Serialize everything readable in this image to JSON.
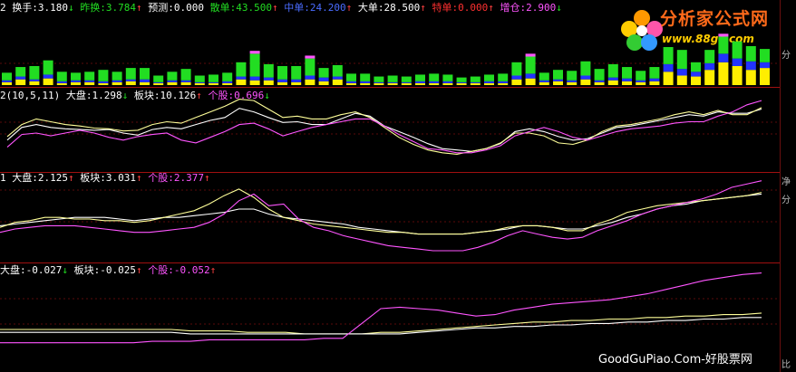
{
  "header": {
    "turnover_label": "换手:",
    "turnover_value": "3.180",
    "turnover_arrow": "↓",
    "prev_label": "昨换:",
    "prev_value": "3.784",
    "prev_arrow": "↑",
    "forecast_label": "预测:",
    "forecast_value": "0.000",
    "retail_label": "散单:",
    "retail_value": "43.500",
    "retail_arrow": "↑",
    "mid_label": "中单:",
    "mid_value": "24.200",
    "mid_arrow": "↑",
    "large_label": "大单:",
    "large_value": "28.500",
    "large_arrow": "↑",
    "xl_label": "特单:",
    "xl_value": "0.000",
    "xl_arrow": "↑",
    "add_label": "增仓:",
    "add_value": "2.900",
    "add_arrow": "↓"
  },
  "panel1": {
    "prefix": "2(10,5,11)",
    "market_label": "大盘:",
    "market_value": "1.298",
    "market_arrow": "↓",
    "sector_label": "板块:",
    "sector_value": "10.126",
    "sector_arrow": "↑",
    "stock_label": "个股:",
    "stock_value": "0.696",
    "stock_arrow": "↓"
  },
  "panel2": {
    "prefix": "1",
    "market_label": "大盘:",
    "market_value": "2.125",
    "market_arrow": "↑",
    "sector_label": "板块:",
    "sector_value": "3.031",
    "sector_arrow": "↑",
    "stock_label": "个股:",
    "stock_value": "2.377",
    "stock_arrow": "↑"
  },
  "panel3": {
    "market_label": "大盘:",
    "market_value": "-0.027",
    "market_arrow": "↓",
    "sector_label": "板块:",
    "sector_value": "-0.025",
    "sector_arrow": "↑",
    "stock_label": "个股:",
    "stock_value": "-0.052",
    "stock_arrow": "↑"
  },
  "logo": {
    "title": "分析家公式网",
    "url": "www.88gs.com"
  },
  "watermark": "GoodGuPiao.Com-好股票网",
  "edge_labels": {
    "a": "分",
    "b": "净",
    "c": "分",
    "d": "比"
  },
  "colors": {
    "green": "#22dd22",
    "blue": "#2233ff",
    "yellow": "#ffee00",
    "magenta": "#ff55ff",
    "white": "#ffffff",
    "paleyellow": "#ffff99"
  },
  "chart_data": [
    {
      "type": "bar",
      "name": "volume",
      "layers": [
        "yellow",
        "blue",
        "green",
        "magenta"
      ],
      "values": [
        [
          3,
          2,
          8,
          0
        ],
        [
          6,
          3,
          10,
          0
        ],
        [
          4,
          2,
          14,
          0
        ],
        [
          7,
          4,
          15,
          0
        ],
        [
          2,
          2,
          10,
          0
        ],
        [
          3,
          2,
          8,
          0
        ],
        [
          3,
          2,
          9,
          0
        ],
        [
          2,
          2,
          12,
          0
        ],
        [
          3,
          2,
          9,
          0
        ],
        [
          4,
          2,
          12,
          0
        ],
        [
          3,
          3,
          12,
          0
        ],
        [
          2,
          1,
          7,
          0
        ],
        [
          3,
          2,
          9,
          0
        ],
        [
          3,
          2,
          12,
          0
        ],
        [
          2,
          1,
          7,
          0
        ],
        [
          2,
          1,
          8,
          0
        ],
        [
          2,
          2,
          9,
          0
        ],
        [
          6,
          3,
          15,
          0
        ],
        [
          5,
          4,
          24,
          3
        ],
        [
          5,
          3,
          14,
          0
        ],
        [
          3,
          3,
          14,
          0
        ],
        [
          3,
          3,
          14,
          0
        ],
        [
          6,
          4,
          18,
          3
        ],
        [
          4,
          4,
          10,
          0
        ],
        [
          6,
          3,
          12,
          0
        ],
        [
          2,
          2,
          8,
          0
        ],
        [
          2,
          2,
          8,
          0
        ],
        [
          2,
          1,
          6,
          0
        ],
        [
          2,
          1,
          7,
          0
        ],
        [
          2,
          1,
          6,
          0
        ],
        [
          2,
          2,
          7,
          0
        ],
        [
          2,
          2,
          8,
          0
        ],
        [
          2,
          2,
          7,
          0
        ],
        [
          2,
          1,
          5,
          0
        ],
        [
          2,
          1,
          6,
          0
        ],
        [
          2,
          2,
          7,
          0
        ],
        [
          2,
          2,
          8,
          0
        ],
        [
          6,
          4,
          14,
          0
        ],
        [
          7,
          5,
          18,
          3
        ],
        [
          3,
          2,
          8,
          0
        ],
        [
          4,
          2,
          10,
          0
        ],
        [
          3,
          2,
          10,
          0
        ],
        [
          6,
          4,
          15,
          0
        ],
        [
          3,
          2,
          12,
          0
        ],
        [
          5,
          3,
          14,
          0
        ],
        [
          4,
          3,
          12,
          0
        ],
        [
          3,
          2,
          10,
          0
        ],
        [
          4,
          3,
          12,
          0
        ],
        [
          14,
          8,
          18,
          0
        ],
        [
          10,
          7,
          20,
          0
        ],
        [
          9,
          5,
          10,
          0
        ],
        [
          16,
          7,
          14,
          0
        ],
        [
          24,
          9,
          18,
          3
        ],
        [
          20,
          8,
          18,
          0
        ],
        [
          16,
          9,
          16,
          0
        ],
        [
          18,
          6,
          14,
          0
        ]
      ]
    },
    {
      "type": "line",
      "name": "panel1",
      "y_range": [
        0,
        100
      ],
      "series": [
        {
          "color": "white",
          "values": [
            40,
            58,
            62,
            58,
            56,
            55,
            54,
            55,
            50,
            47,
            55,
            58,
            56,
            62,
            68,
            72,
            85,
            80,
            72,
            65,
            66,
            62,
            62,
            70,
            78,
            74,
            60,
            52,
            44,
            35,
            28,
            26,
            24,
            28,
            35,
            52,
            56,
            52,
            45,
            40,
            42,
            50,
            58,
            60,
            64,
            68,
            72,
            76,
            74,
            80,
            78,
            78,
            84
          ]
        },
        {
          "color": "paleyellow",
          "values": [
            45,
            62,
            70,
            66,
            62,
            60,
            57,
            56,
            53,
            54,
            62,
            66,
            64,
            72,
            80,
            88,
            98,
            96,
            84,
            72,
            74,
            70,
            70,
            76,
            80,
            72,
            58,
            44,
            34,
            26,
            22,
            20,
            24,
            28,
            36,
            50,
            50,
            46,
            36,
            34,
            40,
            52,
            60,
            62,
            66,
            70,
            76,
            80,
            76,
            82,
            76,
            76,
            86
          ]
        },
        {
          "color": "magenta",
          "values": [
            30,
            48,
            50,
            46,
            50,
            54,
            50,
            44,
            40,
            45,
            48,
            50,
            40,
            36,
            44,
            52,
            62,
            64,
            56,
            46,
            52,
            58,
            62,
            66,
            70,
            70,
            60,
            48,
            38,
            28,
            26,
            22,
            22,
            26,
            32,
            46,
            52,
            58,
            52,
            44,
            40,
            46,
            52,
            56,
            58,
            60,
            64,
            66,
            66,
            74,
            80,
            90,
            96
          ]
        }
      ]
    },
    {
      "type": "line",
      "name": "panel2",
      "y_range": [
        0,
        100
      ],
      "series": [
        {
          "color": "white",
          "values": [
            42,
            44,
            46,
            48,
            50,
            52,
            52,
            52,
            50,
            48,
            50,
            52,
            52,
            54,
            56,
            58,
            62,
            62,
            56,
            52,
            50,
            48,
            46,
            44,
            40,
            38,
            36,
            34,
            32,
            32,
            32,
            32,
            34,
            36,
            38,
            42,
            42,
            40,
            38,
            38,
            42,
            46,
            52,
            56,
            62,
            66,
            68,
            72,
            74,
            76,
            78,
            80
          ]
        },
        {
          "color": "paleyellow",
          "values": [
            40,
            46,
            48,
            52,
            52,
            50,
            50,
            48,
            48,
            46,
            48,
            52,
            56,
            60,
            68,
            78,
            86,
            76,
            62,
            52,
            48,
            44,
            42,
            40,
            38,
            36,
            34,
            34,
            32,
            32,
            32,
            32,
            34,
            36,
            40,
            42,
            42,
            40,
            36,
            36,
            44,
            50,
            58,
            62,
            66,
            68,
            70,
            72,
            74,
            76,
            78,
            82
          ]
        },
        {
          "color": "magenta",
          "values": [
            34,
            38,
            40,
            42,
            42,
            42,
            40,
            38,
            36,
            34,
            34,
            36,
            38,
            40,
            46,
            56,
            72,
            80,
            66,
            68,
            50,
            40,
            36,
            30,
            26,
            22,
            18,
            16,
            14,
            12,
            12,
            12,
            16,
            22,
            30,
            36,
            32,
            28,
            26,
            28,
            36,
            42,
            48,
            56,
            62,
            66,
            70,
            74,
            80,
            88,
            92,
            96
          ]
        }
      ]
    },
    {
      "type": "line",
      "name": "panel3",
      "y_range": [
        0,
        100
      ],
      "series": [
        {
          "color": "paleyellow",
          "values": [
            22,
            22,
            22,
            22,
            22,
            22,
            22,
            22,
            22,
            22,
            20,
            20,
            20,
            18,
            18,
            18,
            16,
            16,
            16,
            16,
            18,
            18,
            20,
            22,
            24,
            26,
            28,
            30,
            32,
            32,
            34,
            34,
            36,
            36,
            38,
            38,
            40,
            40,
            42,
            42,
            44
          ]
        },
        {
          "color": "white",
          "values": [
            18,
            18,
            18,
            18,
            18,
            18,
            18,
            18,
            18,
            18,
            16,
            16,
            16,
            16,
            16,
            16,
            16,
            16,
            16,
            16,
            16,
            16,
            18,
            20,
            22,
            24,
            24,
            26,
            26,
            28,
            28,
            30,
            30,
            32,
            32,
            34,
            34,
            36,
            36,
            38,
            38
          ]
        },
        {
          "color": "magenta",
          "values": [
            4,
            4,
            4,
            4,
            4,
            4,
            4,
            4,
            6,
            6,
            6,
            8,
            8,
            8,
            8,
            8,
            8,
            10,
            10,
            30,
            50,
            52,
            50,
            48,
            44,
            40,
            42,
            48,
            52,
            56,
            58,
            60,
            62,
            66,
            70,
            76,
            82,
            88,
            92,
            96,
            98
          ]
        }
      ]
    }
  ]
}
